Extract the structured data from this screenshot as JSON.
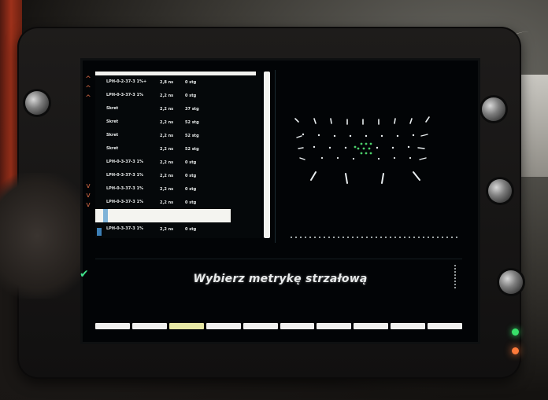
{
  "list": {
    "rows": [
      {
        "name": "LPH-0-2-37-3 1%+",
        "v1": "2,8 ns",
        "v2": "0 stg"
      },
      {
        "name": "LPH-0-3-37-3 1%",
        "v1": "2,2 ns",
        "v2": "0 stg"
      },
      {
        "name": "Skret",
        "v1": "2,2 ns",
        "v2": "37 stg"
      },
      {
        "name": "Skret",
        "v1": "2,2 ns",
        "v2": "52 stg"
      },
      {
        "name": "Skret",
        "v1": "2,2 ns",
        "v2": "52 stg"
      },
      {
        "name": "Skret",
        "v1": "2,2 ns",
        "v2": "52 stg"
      },
      {
        "name": "LPH-0-3-37-3 1%",
        "v1": "2,2 ns",
        "v2": "0 stg"
      },
      {
        "name": "LPH-0-3-37-3 1%",
        "v1": "2,2 ns",
        "v2": "0 stg"
      },
      {
        "name": "LPH-0-3-37-3 1%",
        "v1": "2,2 ns",
        "v2": "0 stg"
      },
      {
        "name": "LPH-0-3-37-3 1%",
        "v1": "2,2 ns",
        "v2": "0 stg"
      },
      {
        "name": "",
        "v1": "",
        "v2": ""
      },
      {
        "name": "LPH-0-3-37-3 1%",
        "v1": "2,2 ns",
        "v2": "0 stg"
      }
    ]
  },
  "message": "Wybierz metrykę strzałową",
  "colors": {
    "status_led_green": "#38e06a",
    "status_led_orange": "#ff7a3a",
    "chevron": "#d86a45",
    "selection_marker": "#3c7fb6",
    "plot_points": "#e9eef0",
    "plot_center_points": "#4cd06b"
  },
  "icons": {
    "confirm": "check-icon",
    "side_marker": "chevron-icon"
  },
  "softkeys_count": 10
}
